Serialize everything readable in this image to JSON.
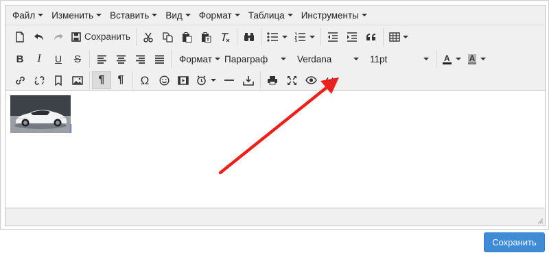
{
  "menubar": {
    "items": [
      {
        "label": "Файл"
      },
      {
        "label": "Изменить"
      },
      {
        "label": "Вставить"
      },
      {
        "label": "Вид"
      },
      {
        "label": "Формат"
      },
      {
        "label": "Таблица"
      },
      {
        "label": "Инструменты"
      }
    ]
  },
  "toolbar": {
    "save_label": "Сохранить",
    "row1_icons": [
      "new-document-icon",
      "undo-icon",
      "redo-icon",
      "save-icon",
      "cut-icon",
      "copy-icon",
      "paste-icon",
      "paste-as-text-icon",
      "clear-formatting-icon",
      "find-replace-icon",
      "bullet-list-icon",
      "numbered-list-icon",
      "outdent-icon",
      "indent-icon",
      "blockquote-icon",
      "table-icon"
    ],
    "row3_icons": [
      "link-icon",
      "unlink-icon",
      "anchor-icon",
      "image-icon",
      "show-blocks-icon",
      "show-invisible-chars-icon",
      "special-character-icon",
      "emoticons-icon",
      "media-icon",
      "insert-datetime-icon",
      "horizontal-line-icon",
      "insert-template-icon",
      "print-icon",
      "fullscreen-icon",
      "preview-icon",
      "source-code-icon"
    ],
    "bold_glyph": "B",
    "italic_glyph": "I",
    "underline_glyph": "U",
    "strikethrough_glyph": "S",
    "format_select": "Формат",
    "block_select": "Параграф",
    "font_select": "Verdana",
    "size_select": "11pt",
    "text_color_glyph": "A",
    "bg_color_glyph": "A",
    "text_color": "#222222",
    "bg_color": "#9b9b9b",
    "pilcrow_glyph": "¶",
    "omega_glyph": "Ω"
  },
  "editor": {
    "image_alt": "white supercar"
  },
  "footer": {
    "save_button_label": "Сохранить",
    "save_button_color": "#3f8bd6"
  },
  "annotation": {
    "arrow_color": "#e8231e",
    "target": "preview-icon"
  }
}
